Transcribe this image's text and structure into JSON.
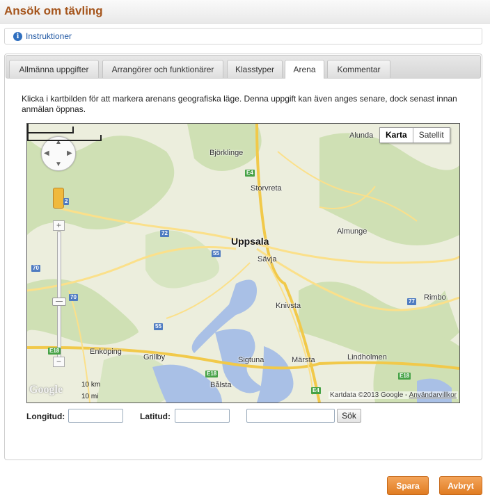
{
  "page": {
    "title": "Ansök om tävling"
  },
  "instructions": {
    "label": "Instruktioner"
  },
  "tabs": [
    {
      "label": "Allmänna uppgifter",
      "active": false
    },
    {
      "label": "Arrangörer och funktionärer",
      "active": false
    },
    {
      "label": "Klasstyper",
      "active": false
    },
    {
      "label": "Arena",
      "active": true
    },
    {
      "label": "Kommentar",
      "active": false
    }
  ],
  "intro_text": "Klicka i kartbilden för att markera arenans geografiska läge. Denna uppgift kan även anges senare, dock senast innan anmälan öppnas.",
  "map": {
    "type_buttons": {
      "map": "Karta",
      "satellite": "Satellit",
      "selected": "Karta"
    },
    "places": [
      {
        "name": "Alunda",
        "big": false
      },
      {
        "name": "Björklinge",
        "big": false
      },
      {
        "name": "Storvreta",
        "big": false
      },
      {
        "name": "Uppsala",
        "big": true
      },
      {
        "name": "Almunge",
        "big": false
      },
      {
        "name": "Sävja",
        "big": false
      },
      {
        "name": "Knivsta",
        "big": false
      },
      {
        "name": "Rimbo",
        "big": false
      },
      {
        "name": "Enköping",
        "big": false
      },
      {
        "name": "Grillby",
        "big": false
      },
      {
        "name": "Sigtuna",
        "big": false
      },
      {
        "name": "Märsta",
        "big": false
      },
      {
        "name": "Lindholmen",
        "big": false
      },
      {
        "name": "Bålsta",
        "big": false
      }
    ],
    "road_numbers": [
      {
        "label": "E4",
        "kind": "green"
      },
      {
        "label": "72",
        "kind": "blue"
      },
      {
        "label": "55",
        "kind": "blue"
      },
      {
        "label": "70",
        "kind": "blue"
      },
      {
        "label": "70",
        "kind": "blue"
      },
      {
        "label": "55",
        "kind": "blue"
      },
      {
        "label": "E18",
        "kind": "green"
      },
      {
        "label": "E4",
        "kind": "green"
      },
      {
        "label": "77",
        "kind": "blue"
      },
      {
        "label": "E18",
        "kind": "green"
      },
      {
        "label": "E18",
        "kind": "green"
      },
      {
        "label": "2",
        "kind": "blue"
      }
    ],
    "scale": {
      "km": "10 km",
      "mi": "10 mi"
    },
    "logo": "Google",
    "attribution": {
      "data": "Kartdata ©2013 Google",
      "separator": "-",
      "terms": "Användarvillkor"
    },
    "zoom": {
      "plus": "+",
      "minus": "−"
    }
  },
  "form": {
    "longitude_label": "Longitud:",
    "longitude_value": "",
    "latitude_label": "Latitud:",
    "latitude_value": "",
    "search_value": "",
    "search_button": "Sök"
  },
  "actions": {
    "save": "Spara",
    "cancel": "Avbryt"
  },
  "colors": {
    "title": "#a5551c",
    "link": "#1f57a3",
    "button": "#e88a2e"
  }
}
